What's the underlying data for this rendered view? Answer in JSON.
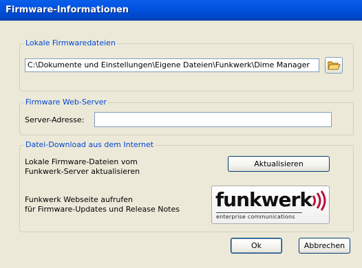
{
  "dialog": {
    "title": "Firmware-Informationen"
  },
  "local_group": {
    "legend": "Lokale Firmwaredateien",
    "path_value": "C:\\Dokumente und Einstellungen\\Eigene Dateien\\Funkwerk\\Dime Manager",
    "browse_icon": "folder-open-icon"
  },
  "server_group": {
    "legend": "Firmware Web-Server",
    "address_label": "Server-Adresse:",
    "address_value": ""
  },
  "download_group": {
    "legend": "Datei-Download aus dem Internet",
    "update_text_line1": "Lokale Firmware-Dateien vom",
    "update_text_line2": "Funkwerk-Server aktualisieren",
    "update_button": "Aktualisieren",
    "website_text_line1": "Funkwerk Webseite aufrufen",
    "website_text_line2": "für Firmware-Updates und Release Notes",
    "logo_text": "funkwerk",
    "logo_tagline": "enterprise communications"
  },
  "buttons": {
    "ok": "Ok",
    "cancel": "Abbrechen"
  },
  "colors": {
    "legend": "#0046D5",
    "logo_red": "#B8123B",
    "titlebar": "#0053E1"
  }
}
